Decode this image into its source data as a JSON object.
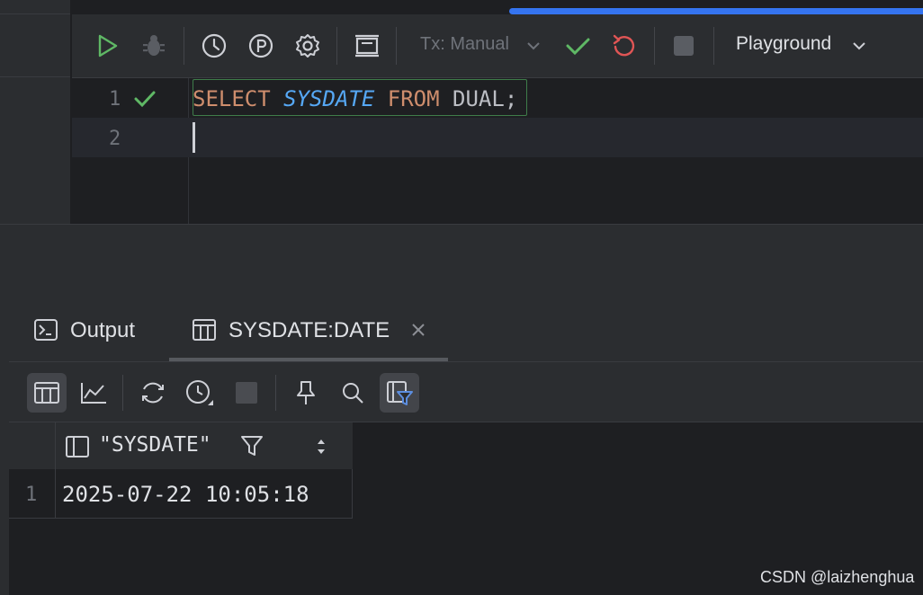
{
  "toolbar": {
    "tx_mode": "Tx: Manual",
    "session": "Playground"
  },
  "editor": {
    "lines": [
      {
        "number": "1",
        "status": "success"
      },
      {
        "number": "2"
      }
    ],
    "tokens": {
      "select": "SELECT",
      "sysdate": "SYSDATE",
      "from": "FROM",
      "dual": "DUAL",
      "semicolon": ";"
    }
  },
  "results": {
    "tabs": [
      {
        "label": "Output"
      },
      {
        "label": "SYSDATE:DATE",
        "active": true
      }
    ],
    "grid": {
      "columns": [
        "\"SYSDATE\""
      ],
      "rows": [
        {
          "num": "1",
          "values": [
            "2025-07-22 10:05:18"
          ]
        }
      ]
    }
  },
  "watermark": "CSDN @laizhenghua",
  "colors": {
    "accent": "#3574f0",
    "success": "#5fb865",
    "rollback": "#e05555",
    "keyword": "#cf8e6d",
    "function": "#56a8f5"
  },
  "icons": {
    "run": "play-icon",
    "debug": "bug-icon",
    "history": "clock-icon",
    "explain": "p-circle-icon",
    "settings": "gear-icon",
    "layout": "panel-icon",
    "commit": "check-icon",
    "rollback": "undo-icon",
    "stop": "stop-icon"
  }
}
